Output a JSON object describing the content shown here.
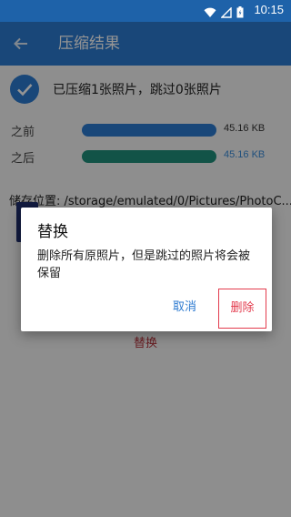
{
  "status_bar": {
    "time": "10:15"
  },
  "app_bar": {
    "back_icon": "arrow-left-icon",
    "title": "压缩结果"
  },
  "result": {
    "icon": "check-circle-icon",
    "text": "已压缩1张照片，跳过0张照片"
  },
  "comparison": {
    "before": {
      "label": "之前",
      "value": "45.16 KB",
      "bar_color": "#2c7ad0",
      "value_color": "#333333"
    },
    "after": {
      "label": "之后",
      "value": "45.16 KB",
      "bar_color": "#1f8f7a",
      "value_color": "#3a8bd8"
    }
  },
  "storage": {
    "path": "储存位置: /storage/emulated/0/Pictures/PhotoC..."
  },
  "bottom_action": {
    "label": "替换"
  },
  "dialog": {
    "title": "替换",
    "message": "删除所有原照片，但是跳过的照片将会被保留",
    "cancel_label": "取消",
    "delete_label": "删除"
  }
}
